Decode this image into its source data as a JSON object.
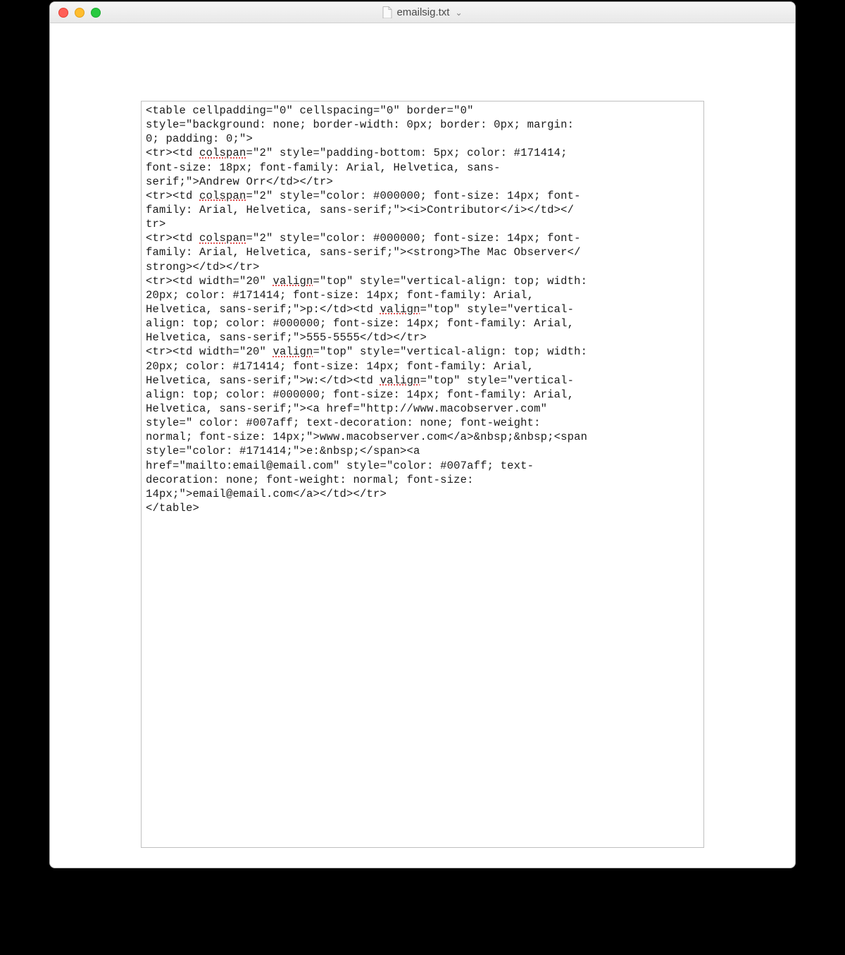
{
  "window": {
    "title": "emailsig.txt"
  },
  "editor": {
    "raw": "",
    "l01": "<table cellpadding=\"0\" cellspacing=\"0\" border=\"0\" ",
    "l02a": "style=\"background: none; border-width: 0px; border: 0px; margin: ",
    "l02b": "0; padding: 0;\">",
    "l03a": "<tr><td ",
    "l03w": "colspan",
    "l03b": "=\"2\" style=\"padding-bottom: 5px; color: #171414; ",
    "l04": "font-size: 18px; font-family: Arial, Helvetica, sans-",
    "l05": "serif;\">Andrew Orr</td></tr>",
    "l06a": "<tr><td ",
    "l06w": "colspan",
    "l06b": "=\"2\" style=\"color: #000000; font-size: 14px; font-",
    "l07": "family: Arial, Helvetica, sans-serif;\"><i>Contributor</i></td></",
    "l08": "tr>",
    "l09a": "<tr><td ",
    "l09w": "colspan",
    "l09b": "=\"2\" style=\"color: #000000; font-size: 14px; font-",
    "l10": "family: Arial, Helvetica, sans-serif;\"><strong>The Mac Observer</",
    "l11": "strong></td></tr>",
    "l12a": "<tr><td width=\"20\" ",
    "l12w": "valign",
    "l12b": "=\"top\" style=\"vertical-align: top; width: ",
    "l13": "20px; color: #171414; font-size: 14px; font-family: Arial, ",
    "l14a": "Helvetica, sans-serif;\">p:</td><td ",
    "l14w": "valign",
    "l14b": "=\"top\" style=\"vertical-",
    "l15": "align: top; color: #000000; font-size: 14px; font-family: Arial, ",
    "l16": "Helvetica, sans-serif;\">555-5555</td></tr>",
    "l17a": "<tr><td width=\"20\" ",
    "l17w": "valign",
    "l17b": "=\"top\" style=\"vertical-align: top; width: ",
    "l18": "20px; color: #171414; font-size: 14px; font-family: Arial, ",
    "l19a": "Helvetica, sans-serif;\">w:</td><td ",
    "l19w": "valign",
    "l19b": "=\"top\" style=\"vertical-",
    "l20": "align: top; color: #000000; font-size: 14px; font-family: Arial, ",
    "l21": "Helvetica, sans-serif;\"><a href=\"http://www.macobserver.com\" ",
    "l22": "style=\" color: #007aff; text-decoration: none; font-weight: ",
    "l23": "normal; font-size: 14px;\">www.macobserver.com</a>&nbsp;&nbsp;<span ",
    "l24": "style=\"color: #171414;\">e:&nbsp;</span><a ",
    "l25": "href=\"mailto:email@email.com\" style=\"color: #007aff; text-",
    "l26": "decoration: none; font-weight: normal; font-size: ",
    "l27": "14px;\">email@email.com</a></td></tr>",
    "l28": "</table>"
  }
}
